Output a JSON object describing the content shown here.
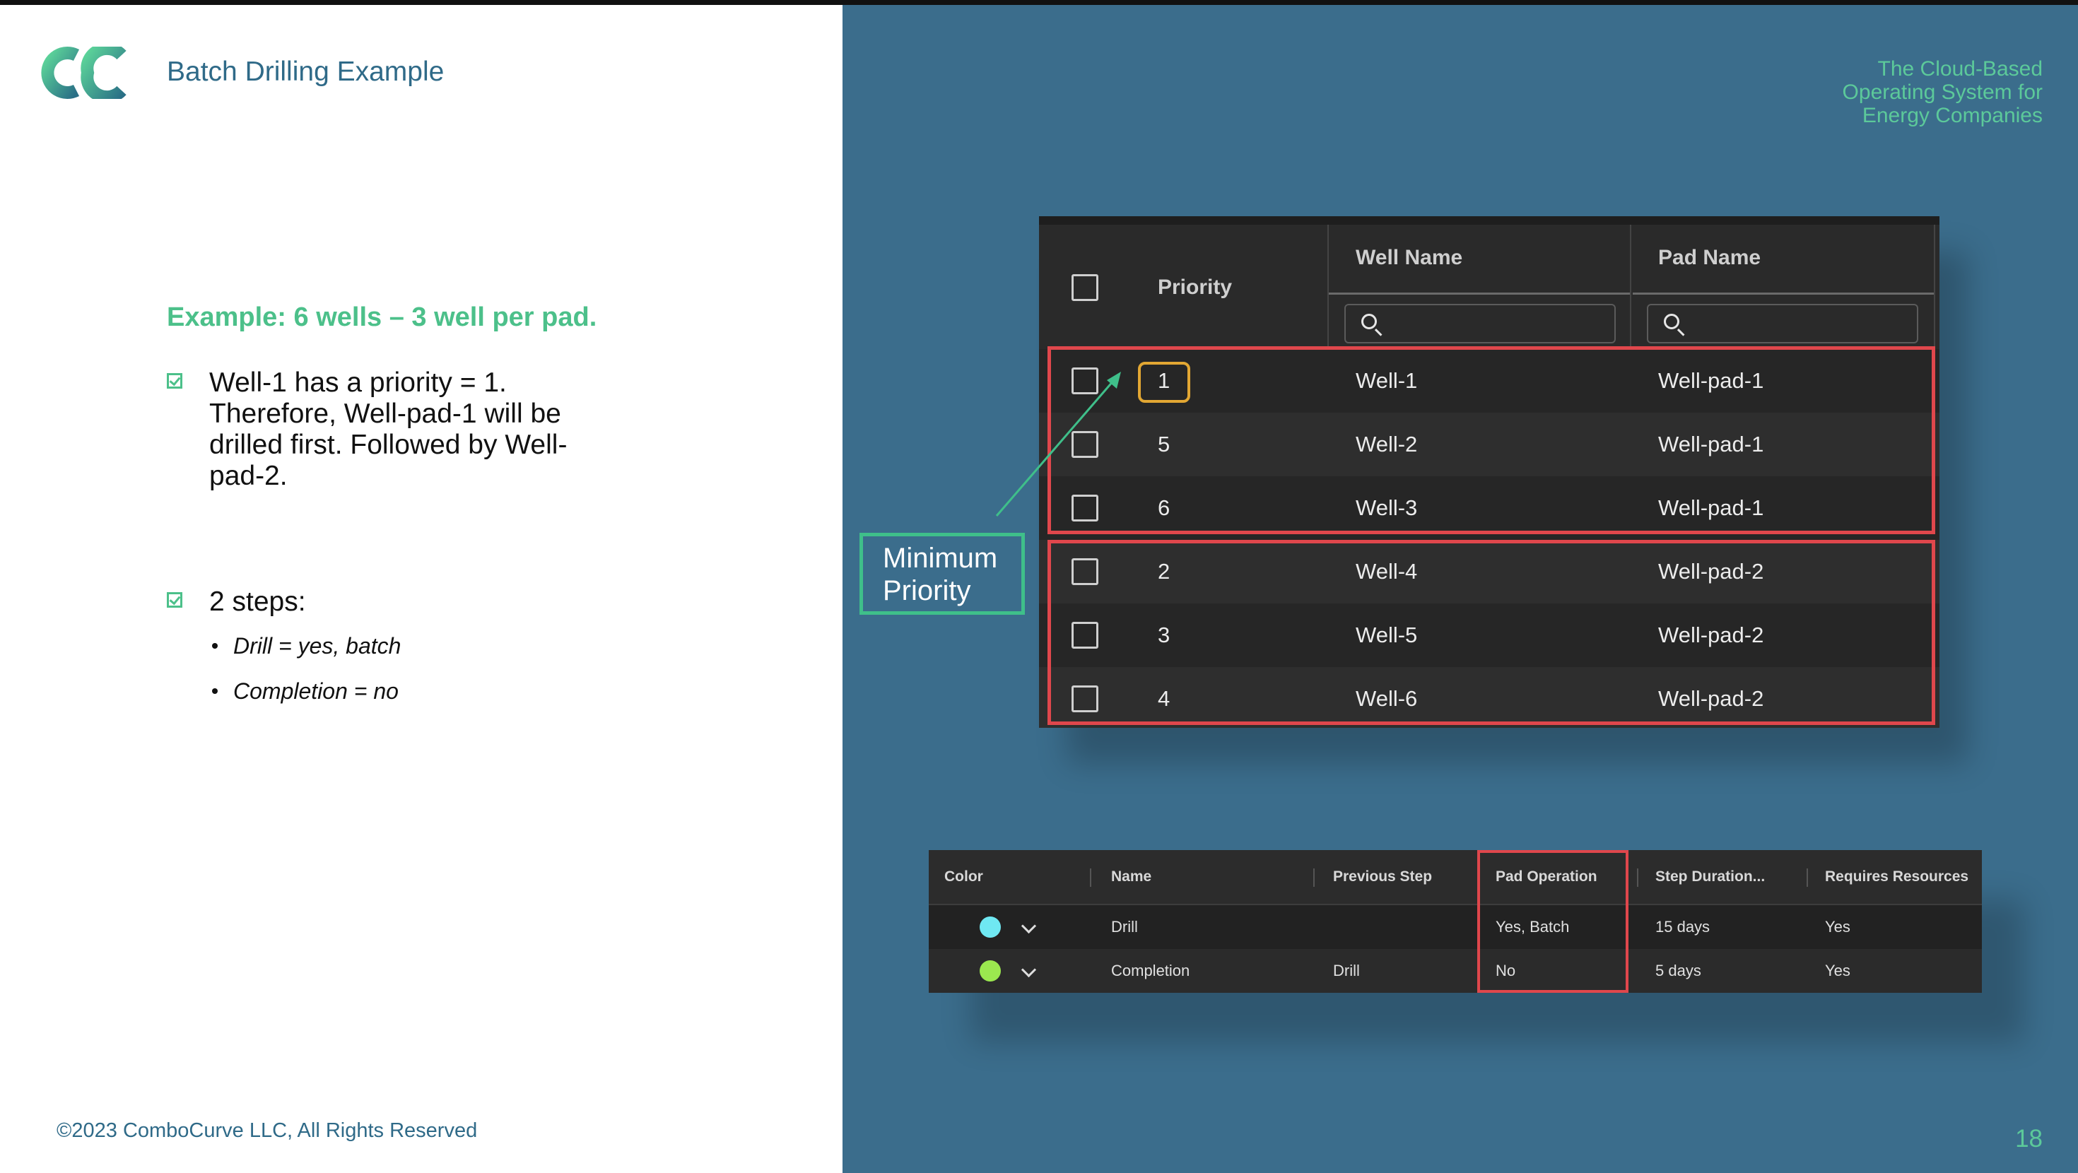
{
  "slide": {
    "title": "Batch Drilling Example",
    "example_heading": "Example: 6 wells – 3 well per pad.",
    "bullet1": "Well-1 has a priority = 1. Therefore, Well-pad-1 will be drilled first. Followed by Well-pad-2.",
    "bullet2": "2 steps:",
    "sub_items": [
      "Drill = yes, batch",
      "Completion = no"
    ],
    "footer": "©2023 ComboCurve LLC, All Rights Reserved",
    "tagline": "The Cloud-Based\nOperating System for\nEnergy Companies",
    "page_number": "18",
    "callout": "Minimum Priority",
    "colors": {
      "brand_teal": "#4cc08a",
      "title_blue": "#2f6a88",
      "panel_bg": "#3b6d8c",
      "highlight_red": "#e0474c",
      "highlight_amber": "#e2a733"
    }
  },
  "wells_table": {
    "headers": {
      "priority": "Priority",
      "well_name": "Well Name",
      "pad_name": "Pad Name"
    },
    "rows": [
      {
        "priority": "1",
        "well": "Well-1",
        "pad": "Well-pad-1"
      },
      {
        "priority": "5",
        "well": "Well-2",
        "pad": "Well-pad-1"
      },
      {
        "priority": "6",
        "well": "Well-3",
        "pad": "Well-pad-1"
      },
      {
        "priority": "2",
        "well": "Well-4",
        "pad": "Well-pad-2"
      },
      {
        "priority": "3",
        "well": "Well-5",
        "pad": "Well-pad-2"
      },
      {
        "priority": "4",
        "well": "Well-6",
        "pad": "Well-pad-2"
      }
    ]
  },
  "steps_table": {
    "headers": {
      "color": "Color",
      "name": "Name",
      "previous_step": "Previous Step",
      "pad_operation": "Pad Operation",
      "step_duration": "Step Duration...",
      "requires_resources": "Requires Resources"
    },
    "rows": [
      {
        "color": "#6fe8f2",
        "name": "Drill",
        "previous_step": "",
        "pad_operation": "Yes, Batch",
        "duration": "15 days",
        "resources": "Yes"
      },
      {
        "color": "#9be84f",
        "name": "Completion",
        "previous_step": "Drill",
        "pad_operation": "No",
        "duration": "5 days",
        "resources": "Yes"
      }
    ]
  }
}
